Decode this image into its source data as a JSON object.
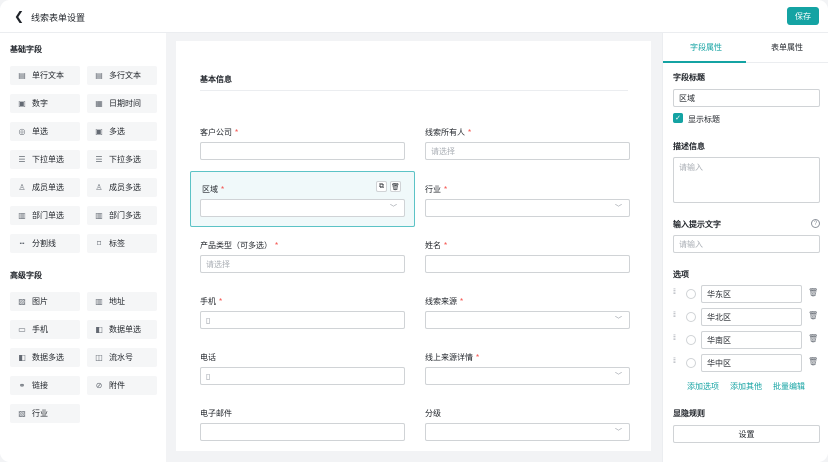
{
  "header": {
    "title": "线索表单设置",
    "save_label": "保存"
  },
  "palette": {
    "basic_title": "基础字段",
    "basic": [
      {
        "label": "单行文本",
        "icon": "single-line-text-icon",
        "glyph": "▤"
      },
      {
        "label": "多行文本",
        "icon": "multi-line-text-icon",
        "glyph": "▤"
      },
      {
        "label": "数字",
        "icon": "number-icon",
        "glyph": "▣"
      },
      {
        "label": "日期时间",
        "icon": "calendar-icon",
        "glyph": "▦"
      },
      {
        "label": "单选",
        "icon": "radio-icon",
        "glyph": "◎"
      },
      {
        "label": "多选",
        "icon": "checkbox-icon",
        "glyph": "▣"
      },
      {
        "label": "下拉单选",
        "icon": "dropdown-single-icon",
        "glyph": "☰"
      },
      {
        "label": "下拉多选",
        "icon": "dropdown-multi-icon",
        "glyph": "☰"
      },
      {
        "label": "成员单选",
        "icon": "member-icon",
        "glyph": "♙"
      },
      {
        "label": "成员多选",
        "icon": "members-icon",
        "glyph": "♙"
      },
      {
        "label": "部门单选",
        "icon": "department-icon",
        "glyph": "▥"
      },
      {
        "label": "部门多选",
        "icon": "departments-icon",
        "glyph": "▥"
      },
      {
        "label": "分割线",
        "icon": "divider-icon",
        "glyph": "┅"
      },
      {
        "label": "标签",
        "icon": "tag-icon",
        "glyph": "⌑"
      }
    ],
    "advanced_title": "高级字段",
    "advanced": [
      {
        "label": "图片",
        "icon": "image-icon",
        "glyph": "▨"
      },
      {
        "label": "地址",
        "icon": "map-icon",
        "glyph": "▥"
      },
      {
        "label": "手机",
        "icon": "phone-icon",
        "glyph": "▭"
      },
      {
        "label": "数据单选",
        "icon": "data-single-icon",
        "glyph": "◧"
      },
      {
        "label": "数据多选",
        "icon": "data-multi-icon",
        "glyph": "◧"
      },
      {
        "label": "流水号",
        "icon": "serial-number-icon",
        "glyph": "◫"
      },
      {
        "label": "链接",
        "icon": "link-icon",
        "glyph": "⚭"
      },
      {
        "label": "附件",
        "icon": "attachment-icon",
        "glyph": "⊘"
      },
      {
        "label": "行业",
        "icon": "industry-icon",
        "glyph": "▧"
      }
    ]
  },
  "form": {
    "section_title": "基本信息",
    "fields": {
      "customer": {
        "label": "客户公司",
        "required": "*",
        "value": ""
      },
      "owner": {
        "label": "线索所有人",
        "required": "*",
        "placeholder": "请选择"
      },
      "region": {
        "label": "区域",
        "required": "*",
        "value": ""
      },
      "industry": {
        "label": "行业",
        "required": "*",
        "value": ""
      },
      "product": {
        "label": "产品类型（可多选）",
        "required": "*",
        "placeholder": "请选择"
      },
      "name": {
        "label": "姓名",
        "required": "*",
        "value": ""
      },
      "mobile": {
        "label": "手机",
        "required": "*",
        "value": ""
      },
      "source": {
        "label": "线索来源",
        "required": "*",
        "value": ""
      },
      "phone": {
        "label": "电话",
        "required": "",
        "value": ""
      },
      "online_source": {
        "label": "线上来源详情",
        "required": "*",
        "value": ""
      },
      "email": {
        "label": "电子邮件",
        "required": "",
        "value": ""
      },
      "grade": {
        "label": "分级",
        "required": "",
        "value": ""
      }
    }
  },
  "props": {
    "tabs": [
      "字段属性",
      "表单属性"
    ],
    "title_label": "字段标题",
    "title_value": "区域",
    "show_title_label": "显示标题",
    "desc_label": "描述信息",
    "desc_placeholder": "请输入",
    "hint_label": "输入提示文字",
    "hint_placeholder": "请输入",
    "options_label": "选项",
    "options": [
      "华东区",
      "华北区",
      "华南区",
      "华中区"
    ],
    "add_option": "添加选项",
    "add_other": "添加其他",
    "batch_edit": "批量编辑",
    "visibility_label": "显隐规则",
    "settings_button": "设置"
  },
  "colors": {
    "accent": "#14a3a3",
    "required": "#f54a45",
    "selected_bg": "#f0f9fa"
  }
}
